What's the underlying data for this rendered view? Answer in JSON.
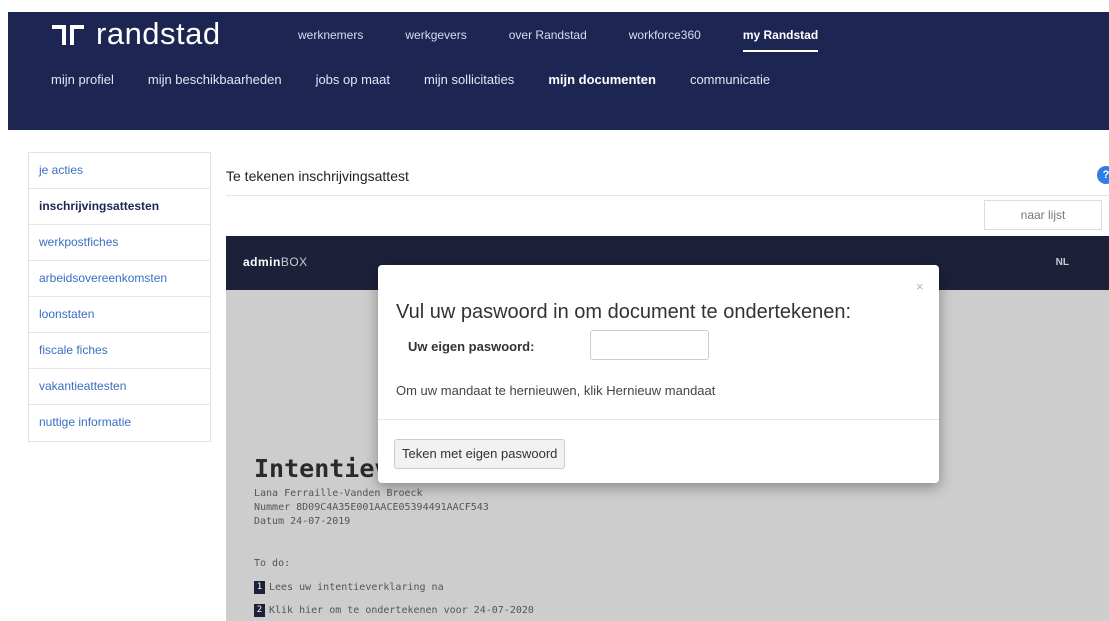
{
  "header": {
    "logo_text": "randstad",
    "top_nav": [
      "werknemers",
      "werkgevers",
      "over Randstad",
      "workforce360",
      "my Randstad"
    ],
    "sub_nav": [
      "mijn profiel",
      "mijn beschikbaarheden",
      "jobs op maat",
      "mijn sollicitaties",
      "mijn documenten",
      "communicatie"
    ]
  },
  "sidebar": {
    "items": [
      "je acties",
      "inschrijvingsattesten",
      "werkpostfiches",
      "arbeidsovereenkomsten",
      "loonstaten",
      "fiscale fiches",
      "vakantieattesten",
      "nuttige informatie"
    ]
  },
  "main": {
    "title": "Te tekenen inschrijvingsattest",
    "back_label": "naar lijst",
    "help": "?"
  },
  "adminbox": {
    "brand_bold": "admin",
    "brand_rest": "BOX",
    "lang": "NL",
    "doc_title": "Intentieve",
    "meta": [
      "Lana Ferraille-Vanden Broeck",
      "Nummer 8D09C4A35E001AACE05394491AACF543",
      "Datum 24-07-2019"
    ],
    "todo_label": "To do:",
    "todos": [
      {
        "num": "1",
        "text": "Lees uw intentieverklaring na"
      },
      {
        "num": "2",
        "text": "Klik hier om te ondertekenen voor 24-07-2020"
      }
    ]
  },
  "modal": {
    "close": "×",
    "heading": "Vul uw paswoord in om document te ondertekenen:",
    "password_label": "Uw eigen paswoord:",
    "info": "Om uw mandaat te hernieuwen, klik Hernieuw mandaat",
    "sign_button": "Teken met eigen paswoord"
  },
  "colors": {
    "header_bg": "#1d2653",
    "adminbox_bar": "#1c2139",
    "link": "#3a6ec2",
    "help": "#2d7ee6"
  }
}
